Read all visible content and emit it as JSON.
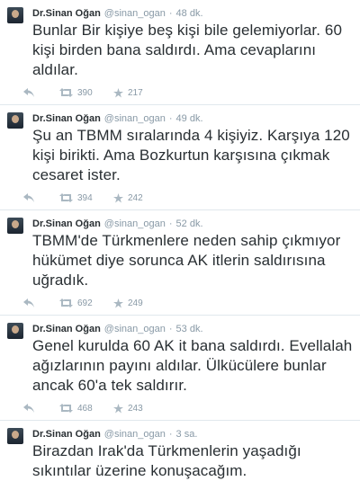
{
  "tweets": [
    {
      "name": "Dr.Sinan Oğan",
      "handle": "@sinan_ogan",
      "time": "48 dk.",
      "text": "Bunlar Bir kişiye beş kişi bile gelemiyorlar. 60 kişi birden bana saldırdı. Ama cevaplarını aldılar.",
      "retweets": "390",
      "favorites": "217"
    },
    {
      "name": "Dr.Sinan Oğan",
      "handle": "@sinan_ogan",
      "time": "49 dk.",
      "text": "Şu an TBMM sıralarında 4 kişiyiz. Karşıya 120 kişi birikti. Ama Bozkurtun karşısına çıkmak cesaret ister.",
      "retweets": "394",
      "favorites": "242"
    },
    {
      "name": "Dr.Sinan Oğan",
      "handle": "@sinan_ogan",
      "time": "52 dk.",
      "text": "TBMM'de Türkmenlere neden sahip çıkmıyor hükümet diye sorunca AK itlerin saldırısına uğradık.",
      "retweets": "692",
      "favorites": "249"
    },
    {
      "name": "Dr.Sinan Oğan",
      "handle": "@sinan_ogan",
      "time": "53 dk.",
      "text": "Genel kurulda 60 AK it bana saldırdı. Evellalah ağızlarının payını aldılar. Ülkücülere bunlar ancak 60'a tek saldırır.",
      "retweets": "468",
      "favorites": "243"
    },
    {
      "name": "Dr.Sinan Oğan",
      "handle": "@sinan_ogan",
      "time": "3 sa.",
      "text": "Birazdan Irak'da Türkmenlerin yaşadığı sıkıntılar üzerine konuşacağım.",
      "retweets": "",
      "favorites": ""
    }
  ]
}
